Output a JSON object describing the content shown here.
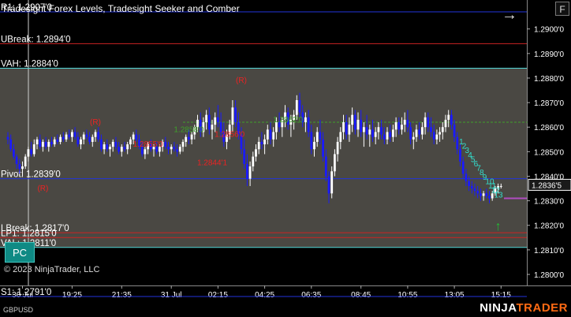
{
  "window": {
    "title": "Tradesight Forex Levels, Tradesight Seeker and Comber",
    "copyright": "© 2023 NinjaTrader, LLC",
    "instrument": "GBPUSD",
    "brand_part1": "NINJA",
    "brand_part2": "TRADER",
    "menu_button": "F",
    "nav_arrow": "→",
    "pc_button": "PC"
  },
  "colors": {
    "background": "#000000",
    "panel": "#4a4843",
    "up_candle": "#ffffff",
    "down_candle": "#1a1aff",
    "red_level": "#cc2222",
    "cyan_level": "#4fd6d6",
    "blue_level": "#2233dd",
    "comber": "#33ddcc",
    "seeker_red": "#ee2222",
    "seeker_green": "#3ea02a",
    "brand_accent": "#ff6a13"
  },
  "chart_data": {
    "type": "candlestick",
    "title": "",
    "ylim": [
      1.27955,
      1.29118
    ],
    "price_ticks": [
      "1.2900'0",
      "1.2890'0",
      "1.2880'0",
      "1.2870'0",
      "1.2860'0",
      "1.2850'0",
      "1.2840'0",
      "1.2830'0",
      "1.2820'0",
      "1.2810'0",
      "1.2800'0"
    ],
    "price_tick_values": [
      1.29,
      1.289,
      1.288,
      1.287,
      1.286,
      1.285,
      1.284,
      1.283,
      1.282,
      1.281,
      1.28
    ],
    "time_labels": [
      "30 Jul",
      "19:25",
      "21:35",
      "31 Jul",
      "02:15",
      "04:25",
      "06:35",
      "08:45",
      "10:55",
      "13:05",
      "15:15"
    ],
    "time_label_index": [
      5,
      22,
      39,
      56,
      72,
      88,
      104,
      121,
      137,
      153,
      169
    ],
    "current_price": "1.2836'5",
    "current_price_value": 1.28365,
    "levels": [
      {
        "label": "R1: 1.2907'0",
        "value": 1.2907,
        "kind": "blue"
      },
      {
        "label": "UBreak: 1.2894'0",
        "value": 1.2894,
        "kind": "red"
      },
      {
        "label": "VAH: 1.2884'0",
        "value": 1.2884,
        "kind": "cyan"
      },
      {
        "label": "Pivot: 1.2839'0",
        "value": 1.2839,
        "kind": "blue"
      },
      {
        "label": "LBreak: 1.2817'0",
        "value": 1.2817,
        "kind": "red"
      },
      {
        "label": "LP1: 1.2815'0",
        "value": 1.2815,
        "kind": "red"
      },
      {
        "label": "VAL: 1.2811'0",
        "value": 1.2811,
        "kind": "cyan"
      },
      {
        "label": "S1: 1.2791'0",
        "value": 1.2791,
        "kind": "blue"
      }
    ],
    "seeker_labels": [
      {
        "text": "(R)",
        "value": 1.2861,
        "index": 30,
        "kind": "red"
      },
      {
        "text": "(R)",
        "value": 1.2878,
        "index": 80,
        "kind": "red"
      },
      {
        "text": "(R)",
        "value": 1.2834,
        "index": 12,
        "kind": "red"
      },
      {
        "text": "1.2855'0",
        "value": 1.2852,
        "index": 48,
        "kind": "red"
      },
      {
        "text": "1.2844'1",
        "value": 1.28445,
        "index": 70,
        "kind": "red"
      },
      {
        "text": "1.2856'0",
        "value": 1.2856,
        "index": 76,
        "kind": "red"
      },
      {
        "text": "1.2858'0",
        "value": 1.2858,
        "index": 62,
        "kind": "green"
      },
      {
        "text": "1.2862'0",
        "value": 1.2862,
        "index": 96,
        "kind": "green"
      }
    ],
    "comber_counts": [
      "1",
      "2",
      "3",
      "4",
      "5",
      "6",
      "7",
      "8",
      "9",
      "10",
      "11",
      "12",
      "13"
    ],
    "comber_up_arrow": "↑",
    "candles": [
      [
        1.2856,
        1.2858,
        1.2853,
        1.2855
      ],
      [
        1.2855,
        1.2857,
        1.285,
        1.2851
      ],
      [
        1.2851,
        1.2853,
        1.2847,
        1.2848
      ],
      [
        1.2848,
        1.2849,
        1.2843,
        1.2845
      ],
      [
        1.2845,
        1.2847,
        1.2841,
        1.2843
      ],
      [
        1.2843,
        1.2846,
        1.284,
        1.2844
      ],
      [
        1.2844,
        1.2849,
        1.2843,
        1.2848
      ],
      [
        1.2848,
        1.2852,
        1.2846,
        1.2851
      ],
      [
        1.2851,
        1.2854,
        1.2848,
        1.2849
      ],
      [
        1.2849,
        1.2855,
        1.2848,
        1.2853
      ],
      [
        1.2853,
        1.2856,
        1.2851,
        1.2855
      ],
      [
        1.2855,
        1.2857,
        1.2851,
        1.2852
      ],
      [
        1.2852,
        1.2855,
        1.285,
        1.2854
      ],
      [
        1.2854,
        1.2856,
        1.2851,
        1.2852
      ],
      [
        1.2852,
        1.2855,
        1.285,
        1.2854
      ],
      [
        1.2854,
        1.2856,
        1.2852,
        1.2853
      ],
      [
        1.2853,
        1.2856,
        1.2852,
        1.2855
      ],
      [
        1.2855,
        1.2857,
        1.2853,
        1.2854
      ],
      [
        1.2854,
        1.2857,
        1.2853,
        1.2856
      ],
      [
        1.2856,
        1.2858,
        1.2854,
        1.2855
      ],
      [
        1.2855,
        1.2858,
        1.2854,
        1.2857
      ],
      [
        1.2857,
        1.2859,
        1.2855,
        1.2856
      ],
      [
        1.2856,
        1.2859,
        1.2854,
        1.2858
      ],
      [
        1.2858,
        1.286,
        1.2855,
        1.2856
      ],
      [
        1.2856,
        1.2858,
        1.2852,
        1.2853
      ],
      [
        1.2853,
        1.2856,
        1.2851,
        1.2855
      ],
      [
        1.2855,
        1.2858,
        1.2853,
        1.2857
      ],
      [
        1.2857,
        1.2859,
        1.2855,
        1.2856
      ],
      [
        1.2856,
        1.2858,
        1.2853,
        1.2854
      ],
      [
        1.2854,
        1.2857,
        1.2852,
        1.2856
      ],
      [
        1.2856,
        1.2859,
        1.2854,
        1.2858
      ],
      [
        1.2858,
        1.286,
        1.2854,
        1.2855
      ],
      [
        1.2855,
        1.2857,
        1.285,
        1.2851
      ],
      [
        1.2851,
        1.2854,
        1.2849,
        1.2853
      ],
      [
        1.2853,
        1.2855,
        1.285,
        1.2851
      ],
      [
        1.2851,
        1.2853,
        1.2848,
        1.2852
      ],
      [
        1.2852,
        1.2855,
        1.285,
        1.2854
      ],
      [
        1.2854,
        1.2856,
        1.2851,
        1.2852
      ],
      [
        1.2852,
        1.2854,
        1.2849,
        1.285
      ],
      [
        1.285,
        1.2853,
        1.2848,
        1.2852
      ],
      [
        1.2852,
        1.2854,
        1.285,
        1.2851
      ],
      [
        1.2851,
        1.2854,
        1.2849,
        1.2853
      ],
      [
        1.2853,
        1.2856,
        1.2851,
        1.2855
      ],
      [
        1.2855,
        1.2858,
        1.2853,
        1.2857
      ],
      [
        1.2857,
        1.2859,
        1.2854,
        1.2855
      ],
      [
        1.2855,
        1.2857,
        1.2851,
        1.2852
      ],
      [
        1.2852,
        1.2854,
        1.2848,
        1.2849
      ],
      [
        1.2849,
        1.2852,
        1.2847,
        1.2851
      ],
      [
        1.2851,
        1.2854,
        1.2849,
        1.2853
      ],
      [
        1.2853,
        1.2855,
        1.285,
        1.2851
      ],
      [
        1.2851,
        1.2853,
        1.2848,
        1.2852
      ],
      [
        1.2852,
        1.2854,
        1.2849,
        1.285
      ],
      [
        1.285,
        1.2853,
        1.2848,
        1.2852
      ],
      [
        1.2852,
        1.2855,
        1.285,
        1.2854
      ],
      [
        1.2854,
        1.2856,
        1.2851,
        1.2852
      ],
      [
        1.2852,
        1.2854,
        1.2849,
        1.2851
      ],
      [
        1.2851,
        1.2853,
        1.2849,
        1.2852
      ],
      [
        1.2852,
        1.2854,
        1.285,
        1.2851
      ],
      [
        1.2851,
        1.2853,
        1.2848,
        1.285
      ],
      [
        1.285,
        1.2853,
        1.2849,
        1.2852
      ],
      [
        1.2852,
        1.2855,
        1.285,
        1.2854
      ],
      [
        1.2854,
        1.2857,
        1.2852,
        1.2856
      ],
      [
        1.2856,
        1.2859,
        1.2853,
        1.2855
      ],
      [
        1.2855,
        1.2858,
        1.2853,
        1.2857
      ],
      [
        1.2857,
        1.2861,
        1.2855,
        1.286
      ],
      [
        1.286,
        1.2865,
        1.2858,
        1.2863
      ],
      [
        1.2863,
        1.2866,
        1.2856,
        1.2858
      ],
      [
        1.2858,
        1.2864,
        1.2856,
        1.2862
      ],
      [
        1.2862,
        1.2867,
        1.2859,
        1.2865
      ],
      [
        1.2865,
        1.2868,
        1.2857,
        1.2859
      ],
      [
        1.2859,
        1.2863,
        1.2855,
        1.2861
      ],
      [
        1.2861,
        1.2866,
        1.2858,
        1.2864
      ],
      [
        1.2864,
        1.2869,
        1.286,
        1.2862
      ],
      [
        1.2862,
        1.2866,
        1.2856,
        1.2858
      ],
      [
        1.2858,
        1.2862,
        1.2852,
        1.2854
      ],
      [
        1.2854,
        1.2859,
        1.2851,
        1.2857
      ],
      [
        1.2857,
        1.2863,
        1.2855,
        1.2861
      ],
      [
        1.2861,
        1.2871,
        1.2858,
        1.2868
      ],
      [
        1.2868,
        1.2871,
        1.286,
        1.2862
      ],
      [
        1.2862,
        1.2866,
        1.2855,
        1.2857
      ],
      [
        1.2857,
        1.286,
        1.2849,
        1.2851
      ],
      [
        1.2851,
        1.2855,
        1.2843,
        1.2845
      ],
      [
        1.2845,
        1.2849,
        1.2836,
        1.2839
      ],
      [
        1.2839,
        1.2846,
        1.2836,
        1.2844
      ],
      [
        1.2844,
        1.285,
        1.2842,
        1.2848
      ],
      [
        1.2848,
        1.2853,
        1.2846,
        1.2851
      ],
      [
        1.2851,
        1.2856,
        1.2849,
        1.2854
      ],
      [
        1.2854,
        1.2858,
        1.2851,
        1.2853
      ],
      [
        1.2853,
        1.2857,
        1.2849,
        1.2855
      ],
      [
        1.2855,
        1.2861,
        1.2853,
        1.2859
      ],
      [
        1.2859,
        1.2862,
        1.2853,
        1.2855
      ],
      [
        1.2855,
        1.286,
        1.2852,
        1.2858
      ],
      [
        1.2858,
        1.2864,
        1.2855,
        1.2862
      ],
      [
        1.2862,
        1.2866,
        1.2858,
        1.286
      ],
      [
        1.286,
        1.2864,
        1.2856,
        1.2863
      ],
      [
        1.2863,
        1.2869,
        1.286,
        1.2866
      ],
      [
        1.2866,
        1.2868,
        1.2859,
        1.2861
      ],
      [
        1.2861,
        1.2865,
        1.2856,
        1.2863
      ],
      [
        1.2863,
        1.2867,
        1.2859,
        1.2865
      ],
      [
        1.2865,
        1.2873,
        1.2863,
        1.2871
      ],
      [
        1.2871,
        1.2874,
        1.2864,
        1.2866
      ],
      [
        1.2866,
        1.2869,
        1.286,
        1.2862
      ],
      [
        1.2862,
        1.2866,
        1.2858,
        1.2864
      ],
      [
        1.2864,
        1.2867,
        1.2856,
        1.2858
      ],
      [
        1.2858,
        1.2861,
        1.2849,
        1.2851
      ],
      [
        1.2851,
        1.2856,
        1.2848,
        1.2854
      ],
      [
        1.2854,
        1.286,
        1.2852,
        1.2858
      ],
      [
        1.2858,
        1.2863,
        1.2853,
        1.2855
      ],
      [
        1.2855,
        1.2858,
        1.2846,
        1.2848
      ],
      [
        1.2848,
        1.2851,
        1.2838,
        1.284
      ],
      [
        1.284,
        1.2842,
        1.2829,
        1.2833
      ],
      [
        1.2833,
        1.2844,
        1.2831,
        1.2842
      ],
      [
        1.2842,
        1.2851,
        1.284,
        1.2849
      ],
      [
        1.2849,
        1.2856,
        1.2846,
        1.2854
      ],
      [
        1.2854,
        1.286,
        1.2851,
        1.2858
      ],
      [
        1.2858,
        1.2865,
        1.2855,
        1.2862
      ],
      [
        1.2862,
        1.2865,
        1.2855,
        1.2857
      ],
      [
        1.2857,
        1.2864,
        1.2854,
        1.2861
      ],
      [
        1.2861,
        1.2868,
        1.2858,
        1.2865
      ],
      [
        1.2865,
        1.2867,
        1.2857,
        1.2859
      ],
      [
        1.2859,
        1.2866,
        1.2856,
        1.2863
      ],
      [
        1.2863,
        1.2867,
        1.2856,
        1.2858
      ],
      [
        1.2858,
        1.2862,
        1.2852,
        1.286
      ],
      [
        1.286,
        1.2865,
        1.2855,
        1.2857
      ],
      [
        1.2857,
        1.2861,
        1.2852,
        1.2859
      ],
      [
        1.2859,
        1.2863,
        1.2854,
        1.2856
      ],
      [
        1.2856,
        1.286,
        1.2853,
        1.2858
      ],
      [
        1.2858,
        1.2862,
        1.2855,
        1.286
      ],
      [
        1.286,
        1.2863,
        1.2855,
        1.2857
      ],
      [
        1.2857,
        1.286,
        1.2853,
        1.2855
      ],
      [
        1.2855,
        1.286,
        1.2853,
        1.2858
      ],
      [
        1.2858,
        1.2861,
        1.2854,
        1.2856
      ],
      [
        1.2856,
        1.2861,
        1.2854,
        1.2859
      ],
      [
        1.2859,
        1.2864,
        1.2856,
        1.2862
      ],
      [
        1.2862,
        1.2864,
        1.2857,
        1.2859
      ],
      [
        1.2859,
        1.2864,
        1.2857,
        1.2861
      ],
      [
        1.2861,
        1.2866,
        1.2858,
        1.2863
      ],
      [
        1.2863,
        1.2867,
        1.2858,
        1.286
      ],
      [
        1.286,
        1.2862,
        1.2853,
        1.2855
      ],
      [
        1.2855,
        1.2858,
        1.2851,
        1.2856
      ],
      [
        1.2856,
        1.2861,
        1.2854,
        1.2859
      ],
      [
        1.2859,
        1.2862,
        1.2855,
        1.2857
      ],
      [
        1.2857,
        1.2862,
        1.2855,
        1.286
      ],
      [
        1.286,
        1.2866,
        1.2857,
        1.2864
      ],
      [
        1.2864,
        1.2866,
        1.2858,
        1.286
      ],
      [
        1.286,
        1.2864,
        1.2856,
        1.2858
      ],
      [
        1.2858,
        1.2861,
        1.2853,
        1.2855
      ],
      [
        1.2855,
        1.2859,
        1.2853,
        1.2857
      ],
      [
        1.2857,
        1.286,
        1.2854,
        1.2858
      ],
      [
        1.2858,
        1.2862,
        1.2855,
        1.286
      ],
      [
        1.286,
        1.2865,
        1.2858,
        1.2863
      ],
      [
        1.2863,
        1.2867,
        1.286,
        1.2865
      ],
      [
        1.2865,
        1.2867,
        1.2859,
        1.2861
      ],
      [
        1.2861,
        1.2863,
        1.2854,
        1.2856
      ],
      [
        1.2856,
        1.2858,
        1.2849,
        1.2851
      ],
      [
        1.2851,
        1.2853,
        1.2844,
        1.2846
      ],
      [
        1.2846,
        1.2848,
        1.2839,
        1.2841
      ],
      [
        1.2841,
        1.2843,
        1.2836,
        1.2838
      ],
      [
        1.2838,
        1.284,
        1.2834,
        1.2836
      ],
      [
        1.2836,
        1.2838,
        1.2833,
        1.2835
      ],
      [
        1.2835,
        1.2837,
        1.2832,
        1.2834
      ],
      [
        1.2834,
        1.2836,
        1.2831,
        1.2833
      ],
      [
        1.2833,
        1.2835,
        1.283,
        1.2832
      ],
      [
        1.2832,
        1.2834,
        1.283,
        1.2833
      ],
      [
        1.2833,
        1.2835,
        1.2831,
        1.2832
      ],
      [
        1.2832,
        1.2834,
        1.2829,
        1.2831
      ],
      [
        1.2831,
        1.2834,
        1.283,
        1.2833
      ],
      [
        1.2833,
        1.2836,
        1.2832,
        1.2835
      ],
      [
        1.2835,
        1.2837,
        1.2833,
        1.2836
      ],
      [
        1.2836,
        1.2837,
        1.2835,
        1.2836
      ]
    ]
  }
}
